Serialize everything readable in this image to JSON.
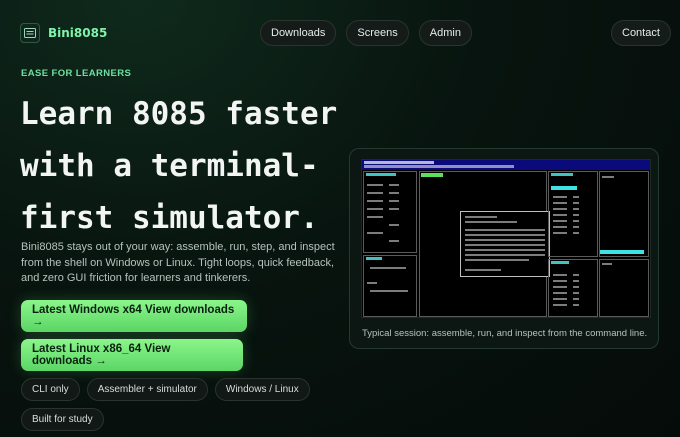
{
  "brand": {
    "name": "Bini8085",
    "icon": "terminal-icon"
  },
  "nav": {
    "links": [
      "Downloads",
      "Screens",
      "Admin"
    ],
    "contact": "Contact"
  },
  "hero": {
    "eyebrow": "EASE FOR LEARNERS",
    "headline": [
      "Learn 8085 faster",
      "with a terminal-",
      "first simulator."
    ],
    "description": "Bini8085 stays out of your way: assemble, run, step, and inspect from the shell on Windows or Linux. Tight loops, quick feedback, and zero GUI friction for learners and tinkerers.",
    "cta_windows": "Latest Windows x64 View downloads →",
    "cta_linux": "Latest Linux x86_64 View downloads →",
    "tags": [
      "CLI only",
      "Assembler + simulator",
      "Windows / Linux",
      "Built for study"
    ]
  },
  "preview": {
    "caption": "Typical session: assemble, run, and inspect from the command line."
  },
  "colors": {
    "accent": "#7ff4a8",
    "cta": "#6ee07a",
    "background": "#06110c"
  }
}
